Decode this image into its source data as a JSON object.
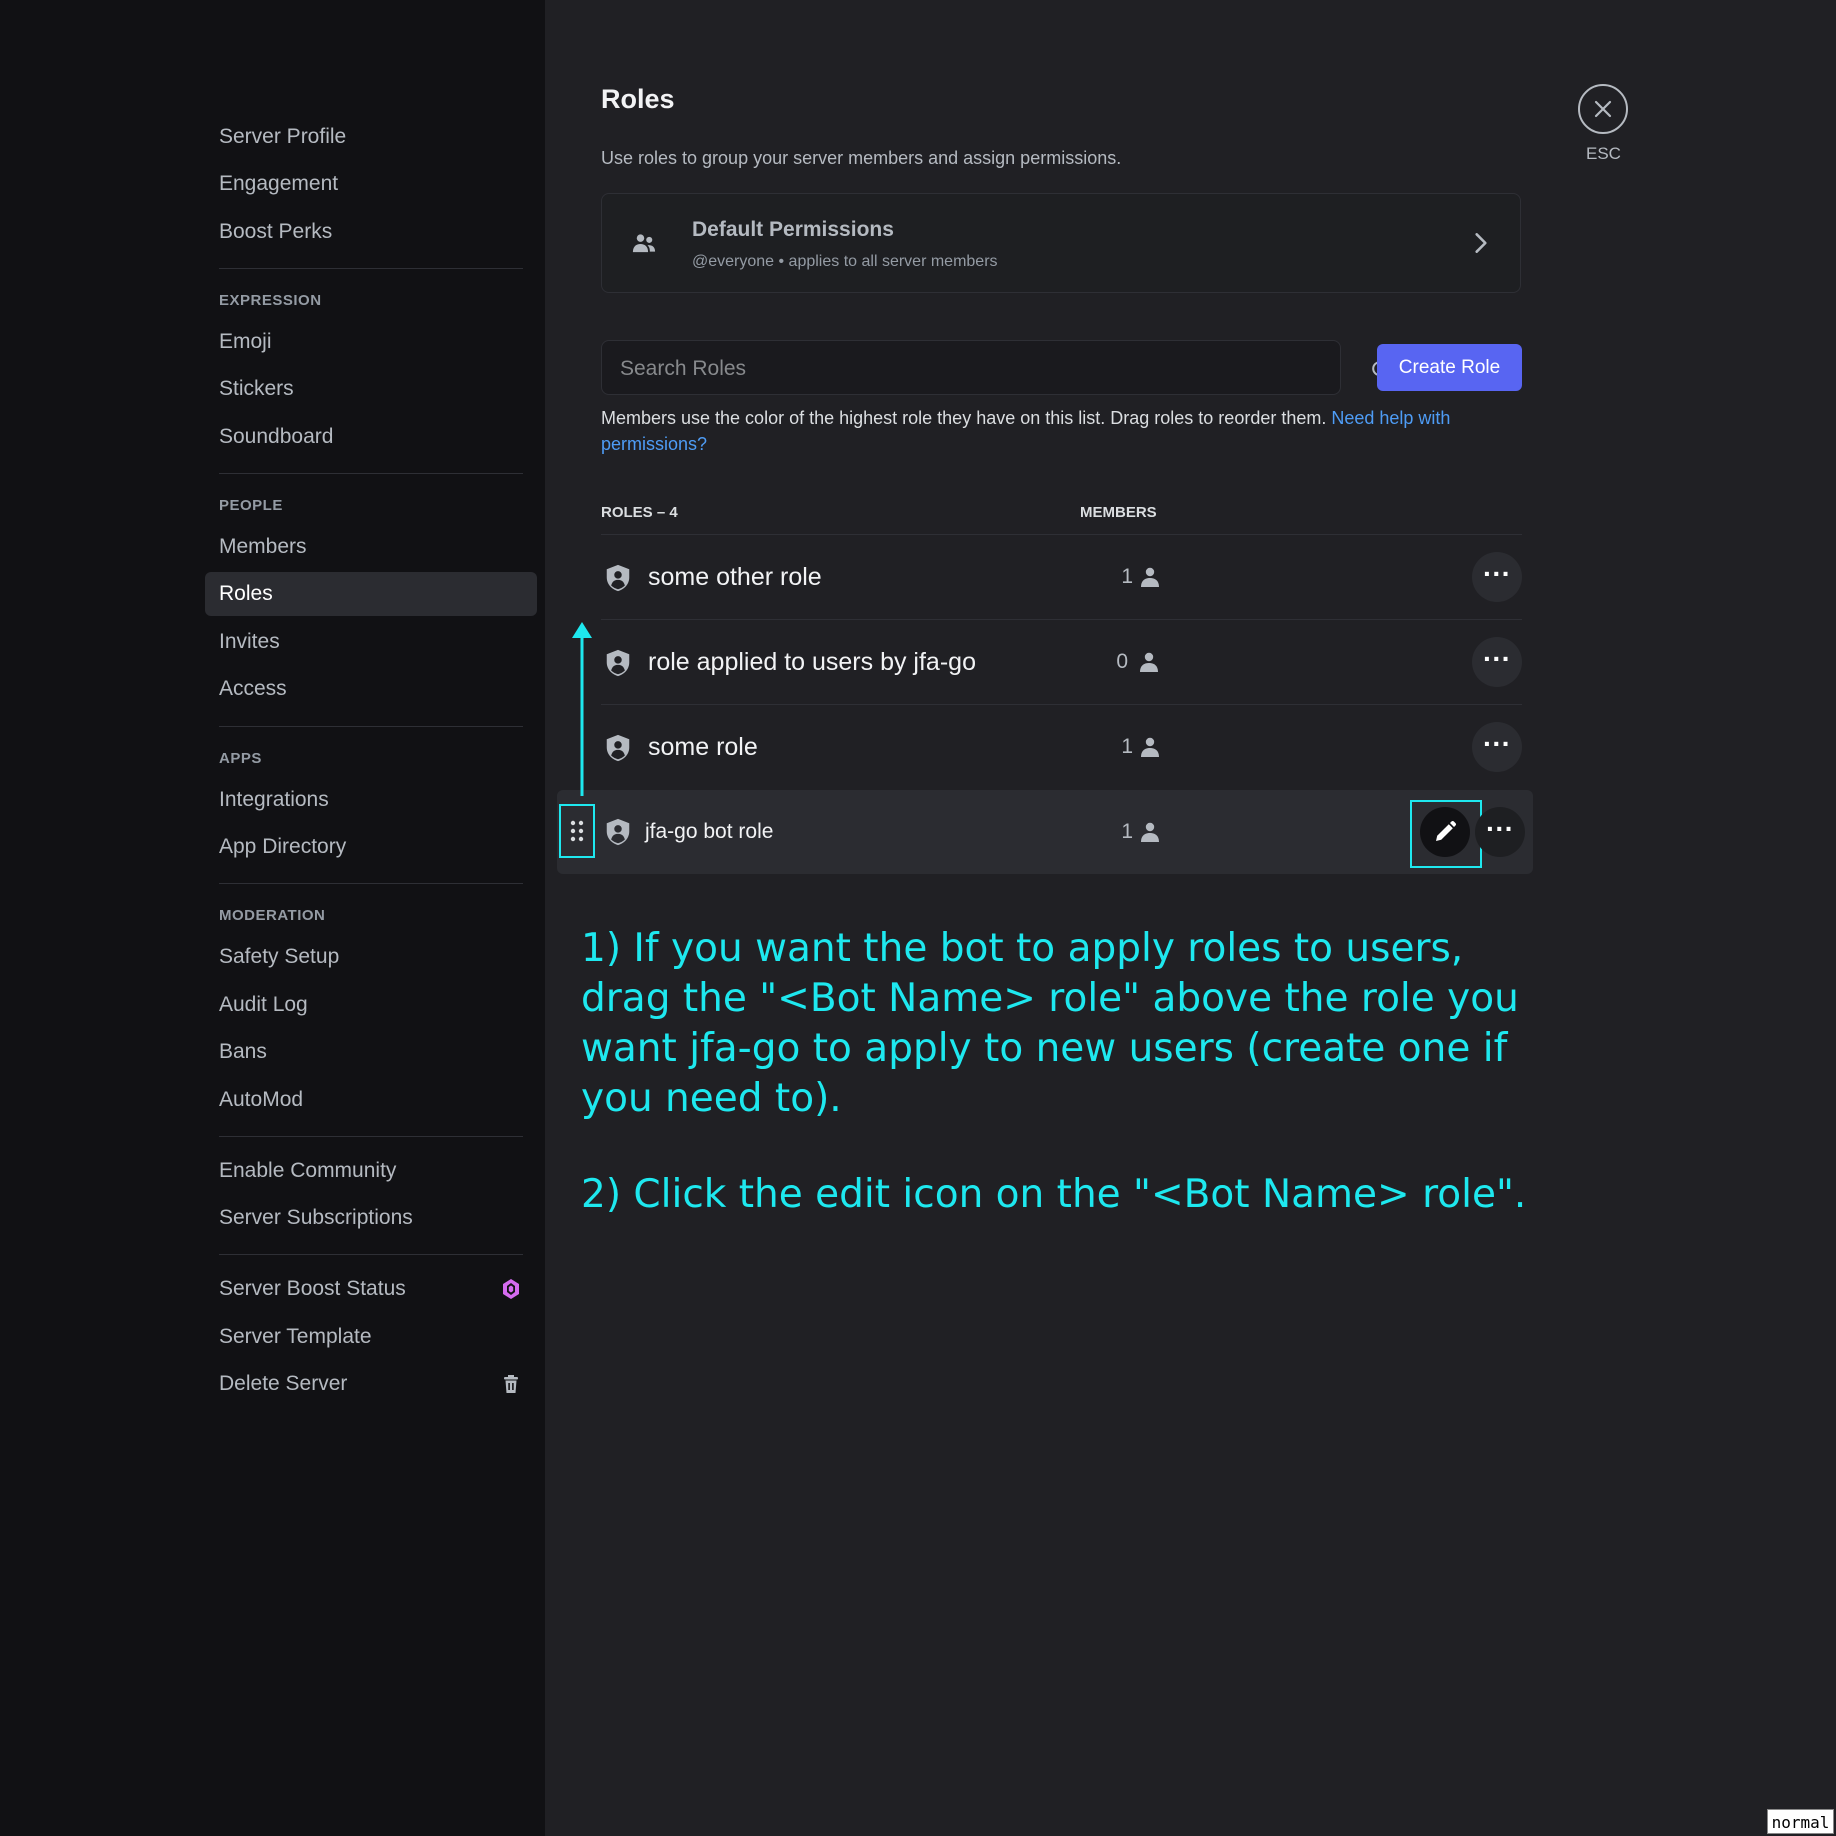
{
  "sidebar": {
    "items": [
      {
        "label": "Server Profile"
      },
      {
        "label": "Engagement"
      },
      {
        "label": "Boost Perks"
      },
      {
        "label": "Emoji"
      },
      {
        "label": "Stickers"
      },
      {
        "label": "Soundboard"
      },
      {
        "label": "Members"
      },
      {
        "label": "Roles"
      },
      {
        "label": "Invites"
      },
      {
        "label": "Access"
      },
      {
        "label": "Integrations"
      },
      {
        "label": "App Directory"
      },
      {
        "label": "Safety Setup"
      },
      {
        "label": "Audit Log"
      },
      {
        "label": "Bans"
      },
      {
        "label": "AutoMod"
      },
      {
        "label": "Enable Community"
      },
      {
        "label": "Server Subscriptions"
      },
      {
        "label": "Server Boost Status"
      },
      {
        "label": "Server Template"
      },
      {
        "label": "Delete Server"
      }
    ],
    "headers": {
      "expression": "EXPRESSION",
      "people": "PEOPLE",
      "apps": "APPS",
      "moderation": "MODERATION"
    },
    "selected": "Roles",
    "boost_icon_color": "#d56bf0"
  },
  "page": {
    "title": "Roles",
    "description": "Use roles to group your server members and assign permissions."
  },
  "default_permissions": {
    "title": "Default Permissions",
    "subtitle": "@everyone • applies to all server members"
  },
  "search": {
    "placeholder": "Search Roles",
    "value": ""
  },
  "create_role_label": "Create Role",
  "hint": {
    "text": "Members use the color of the highest role they have on this list. Drag roles to reorder them. ",
    "link": "Need help with permissions?"
  },
  "roles_table": {
    "col_roles": "ROLES – 4",
    "col_members": "MEMBERS",
    "rows": [
      {
        "name": "some other role",
        "members": "1"
      },
      {
        "name": "role applied to users by jfa-go",
        "members": "0"
      },
      {
        "name": "some role",
        "members": "1"
      },
      {
        "name": "jfa-go bot role",
        "members": "1"
      }
    ]
  },
  "annotations": {
    "step1": "1) If you want the bot to apply roles to users, drag the \"<Bot Name> role\" above the role you want jfa-go to apply to new users (create one if you need to).",
    "step2": "2) Click the edit icon on the \"<Bot Name> role\".",
    "color": "#1ee8ef"
  },
  "close": {
    "label": "ESC"
  },
  "mode_label": "normal",
  "accent_color": "#5865f2"
}
